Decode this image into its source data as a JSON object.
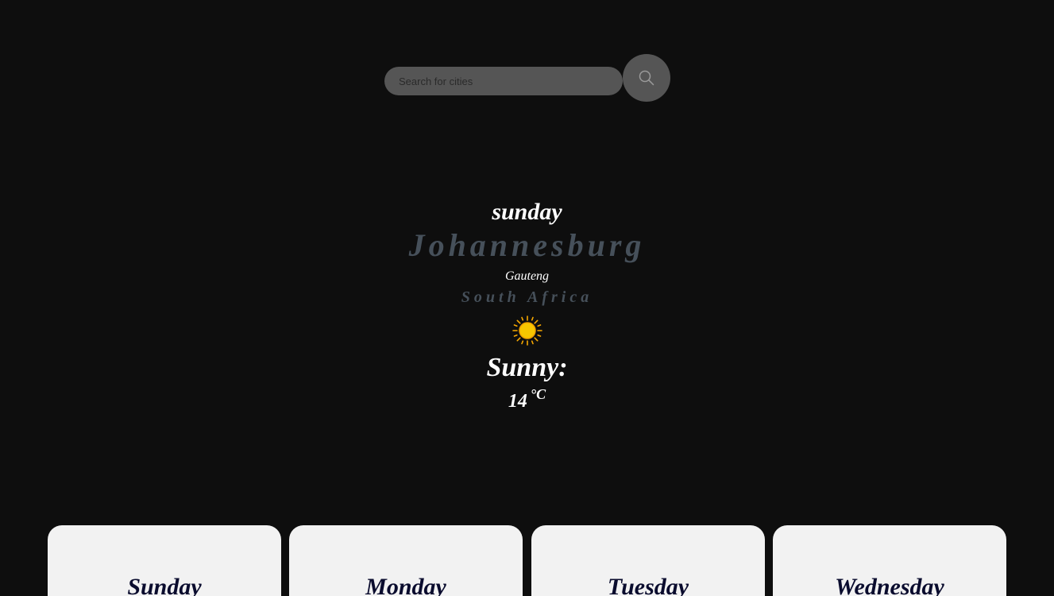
{
  "search": {
    "placeholder": "Search for cities",
    "button_icon": "search-icon"
  },
  "current": {
    "day": "sunday",
    "city": "Johannesburg",
    "region": "Gauteng",
    "country": "South Africa",
    "icon": "sun-icon",
    "condition": "Sunny:",
    "temperature": "14",
    "unit": "°C"
  },
  "forecast": {
    "days": [
      {
        "label": "Sunday"
      },
      {
        "label": "Monday"
      },
      {
        "label": "Tuesday"
      },
      {
        "label": "Wednesday"
      }
    ]
  },
  "colors": {
    "background": "#0e0e0e",
    "search_fill": "#555555",
    "muted_text": "#46505a",
    "card_background": "#f2f2f2",
    "card_text": "#0a0c2e",
    "sun": "#f7c600"
  }
}
